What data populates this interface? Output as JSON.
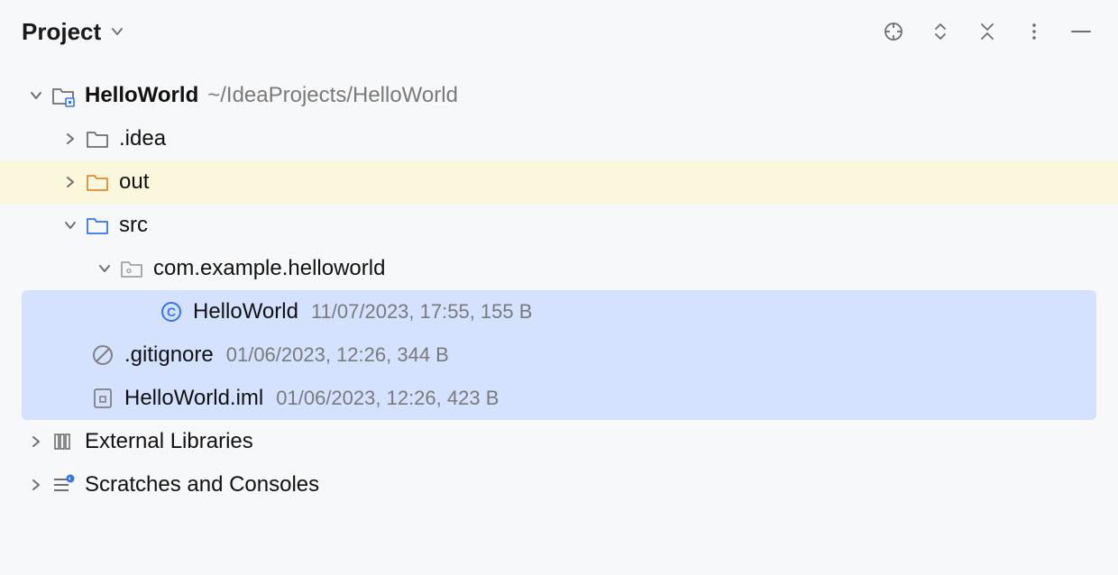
{
  "header": {
    "title": "Project"
  },
  "tree": {
    "root": {
      "name": "HelloWorld",
      "path": "~/IdeaProjects/HelloWorld"
    },
    "idea": {
      "name": ".idea"
    },
    "out": {
      "name": "out"
    },
    "src": {
      "name": "src"
    },
    "pkg": {
      "name": "com.example.helloworld"
    },
    "classFile": {
      "name": "HelloWorld",
      "meta": "11/07/2023, 17:55, 155 B"
    },
    "gitignore": {
      "name": ".gitignore",
      "meta": "01/06/2023, 12:26, 344 B"
    },
    "iml": {
      "name": "HelloWorld.iml",
      "meta": "01/06/2023, 12:26, 423 B"
    },
    "extlib": {
      "name": "External Libraries"
    },
    "scratches": {
      "name": "Scratches and Consoles"
    }
  }
}
